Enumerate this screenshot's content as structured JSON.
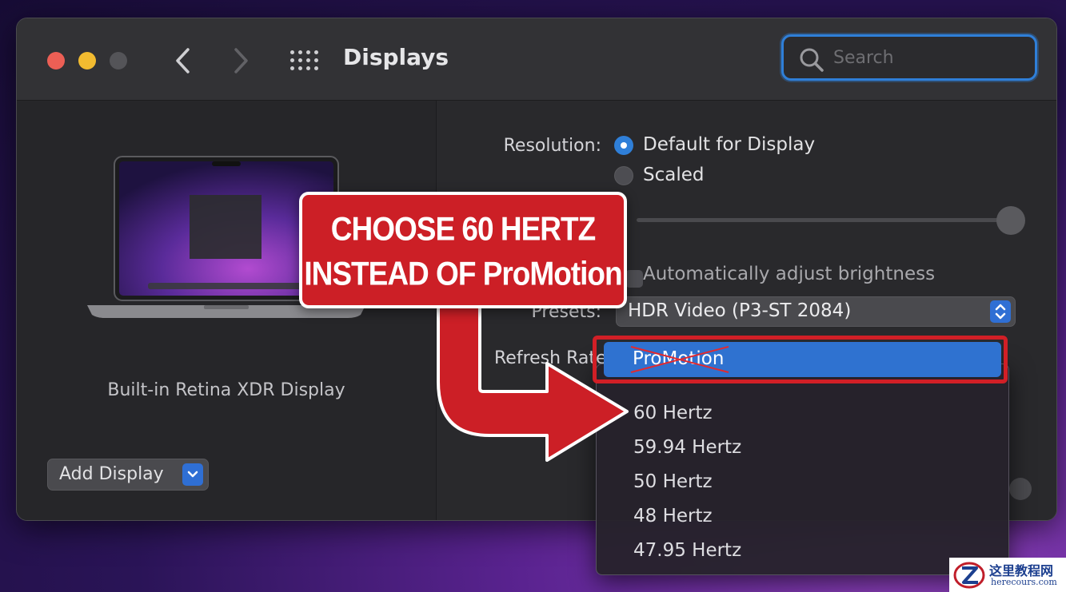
{
  "window": {
    "title": "Displays",
    "search_placeholder": "Search"
  },
  "sidebar": {
    "display_name": "Built-in Retina XDR Display",
    "add_display_label": "Add Display"
  },
  "settings": {
    "resolution_label": "Resolution:",
    "resolution_options": [
      "Default for Display",
      "Scaled"
    ],
    "resolution_selected": "Default for Display",
    "auto_brightness_label": "Automatically adjust brightness",
    "presets_label": "Presets:",
    "presets_value": "HDR Video (P3-ST 2084)",
    "refresh_rate_label": "Refresh Rate"
  },
  "refresh_menu": {
    "selected": "ProMotion",
    "items": [
      "60 Hertz",
      "59.94 Hertz",
      "50 Hertz",
      "48 Hertz",
      "47.95 Hertz"
    ],
    "checked_item": "60 Hertz"
  },
  "callout": {
    "line1": "CHOOSE 60 HERTZ",
    "line2": "INSTEAD OF ProMotion",
    "color": "#cc1f26"
  },
  "watermark": {
    "title": "这里教程网",
    "subtitle": "herecours.com"
  }
}
